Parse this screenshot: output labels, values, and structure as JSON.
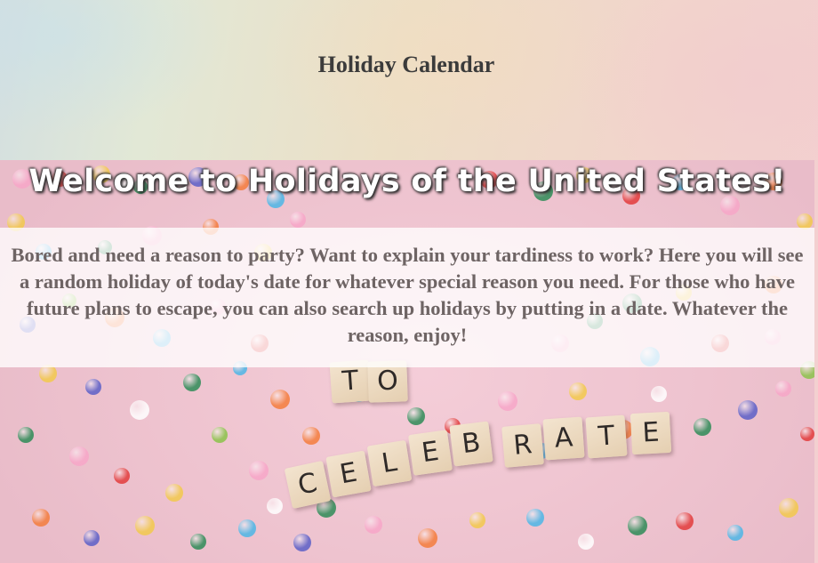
{
  "header": {
    "title": "Holiday Calendar"
  },
  "hero": {
    "heading": "Welcome to Holidays of the United States!",
    "intro": "Bored and need a reason to party? Want to explain your tardiness to work? Here you will see a random holiday of today's date for whatever special reason you need. For those who have future plans to escape, you can also search up holidays by putting in a date. Whatever the reason, enjoy!",
    "background_image": {
      "tile_letters_row1": [
        "T",
        "O"
      ],
      "tile_letters_row2": [
        "C",
        "E",
        "L",
        "E",
        "B",
        "R",
        "A",
        "T",
        "E"
      ],
      "confetti_colors": [
        "#2e8b57",
        "#f47c3c",
        "#e23b3b",
        "#f2c94c",
        "#5b5fc7",
        "#4db6e6",
        "#f7a6c8",
        "#ffffff",
        "#8bc34a"
      ]
    }
  },
  "colors": {
    "title_text": "#3b3b3b",
    "intro_text": "#6e6464",
    "heading_text": "#ffffff",
    "hero_background": "#eec3cf"
  }
}
